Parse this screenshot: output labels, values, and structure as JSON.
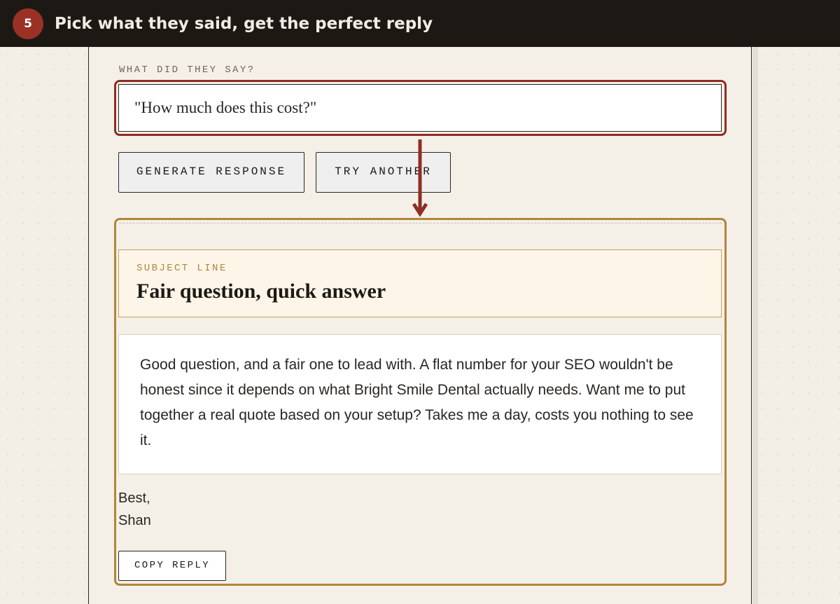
{
  "header": {
    "step_number": "5",
    "title": "Pick what they said, get the perfect reply"
  },
  "prompt": {
    "label": "WHAT DID THEY SAY?",
    "value": "\"How much does this cost?\""
  },
  "actions": {
    "generate_label": "GENERATE RESPONSE",
    "try_another_label": "TRY ANOTHER"
  },
  "result": {
    "subject_label": "SUBJECT LINE",
    "subject": "Fair question, quick answer",
    "body": "Good question, and a fair one to lead with. A flat number for your SEO wouldn't be honest since it depends on what Bright Smile Dental actually needs. Want me to put together a real quote based on your setup? Takes me a day, costs you nothing to see it.",
    "signoff_greeting": "Best,",
    "signoff_name": "Shan",
    "copy_label": "COPY REPLY"
  },
  "colors": {
    "header_bg": "#1c1915",
    "step_badge": "#9a3124",
    "input_highlight": "#8f2e24",
    "arrow": "#8f2e24",
    "result_frame": "#b2853a",
    "subject_bg": "#fcf5e8",
    "subject_label": "#b2853a",
    "page_bg": "#f3efe7"
  },
  "icons": {
    "flow_arrow": "arrow-down-icon"
  }
}
